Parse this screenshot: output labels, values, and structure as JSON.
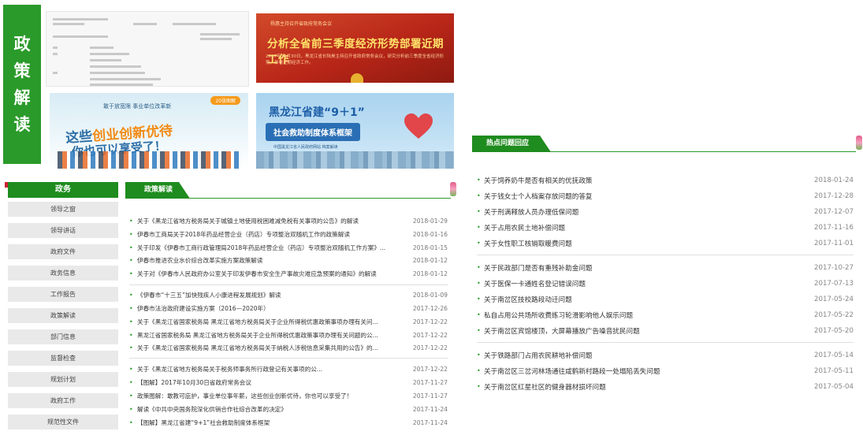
{
  "policy_label": [
    "政",
    "策",
    "解",
    "读"
  ],
  "images": {
    "meeting": {
      "small_text": "杨惠主持召开省政府常务会议",
      "headline": "分析全省前三季度经济形势部署近期工作",
      "desc": "2017年10月30日，黑龙江省长陆昊主持召开省政府常务会议，研究分析前三季度全省经济形势，部署近期经济工作。"
    },
    "startup": {
      "badge": "20张图解",
      "top_text": "敢于放宽限 事业单位改革新",
      "line1_a": "这些",
      "line1_b": "创业创新优待",
      "line2": "你也可以享受了！"
    },
    "rescue": {
      "title": "黑龙江省建“9＋1”",
      "banner": "社会救助制度体系框架",
      "source": "中国黑龙江省人民政府网站 档案解读"
    }
  },
  "sidebar": {
    "title": "政务",
    "items": [
      "领导之窗",
      "领导讲话",
      "政府文件",
      "政务信息",
      "工作报告",
      "政策解读",
      "部门信息",
      "监督检查",
      "规划计划",
      "政府工作",
      "规范性文件"
    ]
  },
  "policy": {
    "title": "政策解读",
    "groups": [
      [
        {
          "title": "关于《黑龙江省地方税务局关于城镇土地使用税困难减免税有关事项的公告》的解读",
          "date": "2018-01-29"
        },
        {
          "title": "伊春市工商局关于2018年药品经营企业（药店）专项整治双随机工作的政策解读",
          "date": "2018-01-16"
        },
        {
          "title": "关于印发《伊春市工商行政管理局2018年药品经营企业（药店）专项整治双随机工作方案》...",
          "date": "2018-01-15"
        },
        {
          "title": "伊春市推进农业水价综合改革实施方案政策解读",
          "date": "2018-01-12"
        },
        {
          "title": "关于对《伊春市人民政府办公室关于印发伊春市安全生产事故灾难应急预案的通知》的解读",
          "date": "2018-01-12"
        }
      ],
      [
        {
          "title": "《伊春市“十三五”加快残疾人小康进程发展规划》解读",
          "date": "2018-01-09"
        },
        {
          "title": "伊春市法治政府建设实施方案（2016—2020年）",
          "date": "2017-12-26"
        },
        {
          "title": "关于《黑龙江省国家税务局 黑龙江省地方税务局关于企业所得税优惠政策事项办理有关问...",
          "date": "2017-12-22"
        },
        {
          "title": "黑龙江省国家税务局 黑龙江省地方税务局关于企业所得税优惠政策事项办理有关问题的公...",
          "date": "2017-12-22"
        },
        {
          "title": "关于《黑龙江省国家税务局 黑龙江省地方税务局关于纳税人涉税信息采集共用的公告》的...",
          "date": "2017-12-22"
        }
      ],
      [
        {
          "title": "关于《黑龙江省地方税务局关于税务师事务所行政登记有关事项的公...",
          "date": "2017-12-22"
        },
        {
          "title": "【图解】2017年10月30日省政府常务会议",
          "date": "2017-11-27"
        },
        {
          "title": "政策图解：敢教可庇护，事业单位事年薪，这些创业创新优待，你也可以享受了！",
          "date": "2017-11-27"
        },
        {
          "title": "解读《中共中央国务院深化供销合作社综合改革的决定》",
          "date": "2017-11-24"
        },
        {
          "title": "【图解】黑龙江省建“9+1”社会救助制度体系框架",
          "date": "2017-11-24"
        }
      ]
    ]
  },
  "hot": {
    "title": "热点问题回应",
    "groups": [
      [
        {
          "title": "关于饲养奶牛是否有相关的优抚政策",
          "date": "2018-01-24"
        },
        {
          "title": "关于钱女士个人档案存放问题的答复",
          "date": "2017-12-28"
        },
        {
          "title": "关于刑满释放人员办理低保问题",
          "date": "2017-12-07"
        },
        {
          "title": "关于占用农民土地补偿问题",
          "date": "2017-11-16"
        },
        {
          "title": "关于女性职工核销取暖费问题",
          "date": "2017-11-01"
        }
      ],
      [
        {
          "title": "关于民政部门是否有重残补助金问题",
          "date": "2017-10-27"
        },
        {
          "title": "关于医保一卡通姓名登记错误问题",
          "date": "2017-07-13"
        },
        {
          "title": "关于南岔区技校路段动迁问题",
          "date": "2017-05-24"
        },
        {
          "title": "私自占用公共场所收费练习轮滑影响他人娱乐问题",
          "date": "2017-05-22"
        },
        {
          "title": "关于南岔区宾馆楼顶，大屏幕播放广告噪音扰民问题",
          "date": "2017-05-20"
        }
      ],
      [
        {
          "title": "关于铁路部门占用农民耕地补偿问题",
          "date": "2017-05-14"
        },
        {
          "title": "关于南岔区三岔河林场通往咸鹤新村路段一处塌陷丢失问题",
          "date": "2017-05-11"
        },
        {
          "title": "关于南岔区红星社区的健身器材损坏问题",
          "date": "2017-05-04"
        }
      ]
    ]
  },
  "colors": {
    "accent_green": "#1e8c1e",
    "meeting_red": "#b82618",
    "date_gray": "#777777"
  }
}
